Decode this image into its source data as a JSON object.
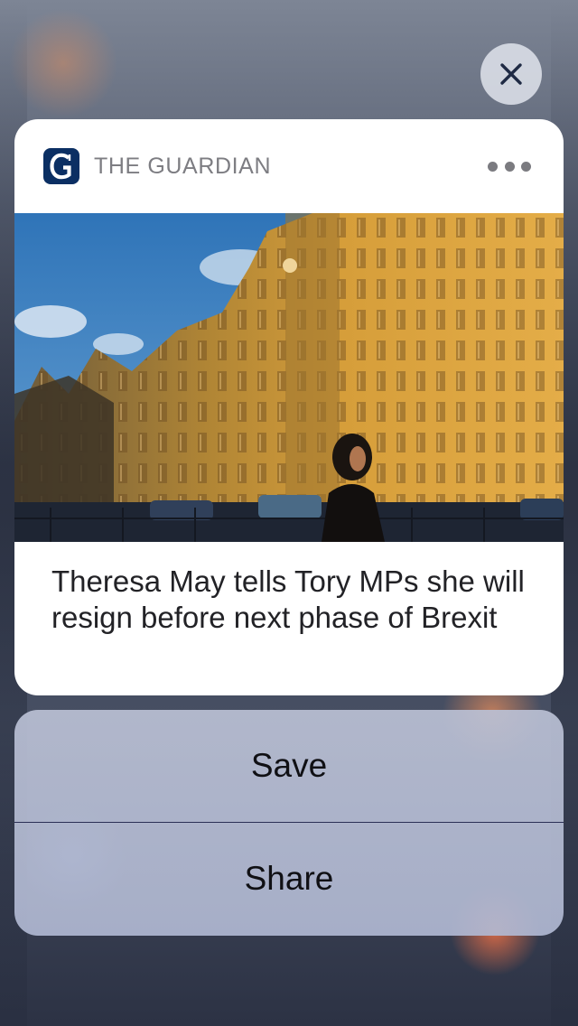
{
  "notification": {
    "app_name": "THE GUARDIAN",
    "app_icon": "guardian-g-logo",
    "more_icon": "ellipsis-icon",
    "headline": "Theresa May tells Tory MPs she will resign before next phase of Brexit",
    "image": "photo of the Palace of Westminster with a woman walking past"
  },
  "close_icon": "close-x-icon",
  "actions": {
    "save_label": "Save",
    "share_label": "Share"
  },
  "colors": {
    "guardian_blue": "#0b2f63",
    "card_background": "#ffffff",
    "action_sheet": "#b7bdd3"
  }
}
